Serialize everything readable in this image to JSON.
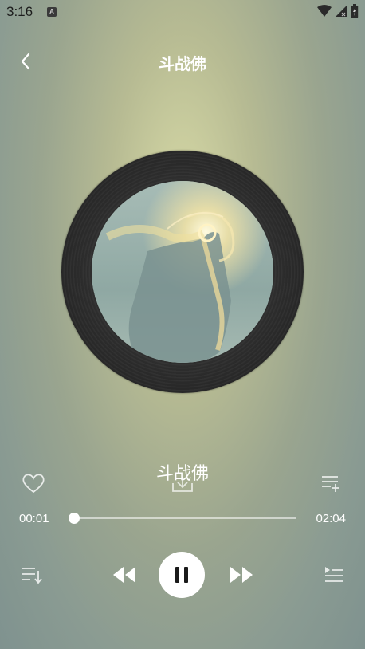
{
  "status_bar": {
    "time": "3:16",
    "notification_badge": "A"
  },
  "header": {
    "title": "斗战佛"
  },
  "player": {
    "song_title": "斗战佛",
    "current_time": "00:01",
    "total_time": "02:04",
    "progress_fraction": 0.01
  },
  "icons": {
    "back": "chevron-left-icon",
    "favorite": "heart-outline-icon",
    "download": "download-icon",
    "add_to_playlist": "playlist-add-icon",
    "sort": "sort-list-icon",
    "previous": "rewind-icon",
    "pause": "pause-icon",
    "next": "fast-forward-icon",
    "queue": "queue-list-icon"
  },
  "colors": {
    "accent": "#ffffff",
    "disc": "#2b2b2b"
  }
}
